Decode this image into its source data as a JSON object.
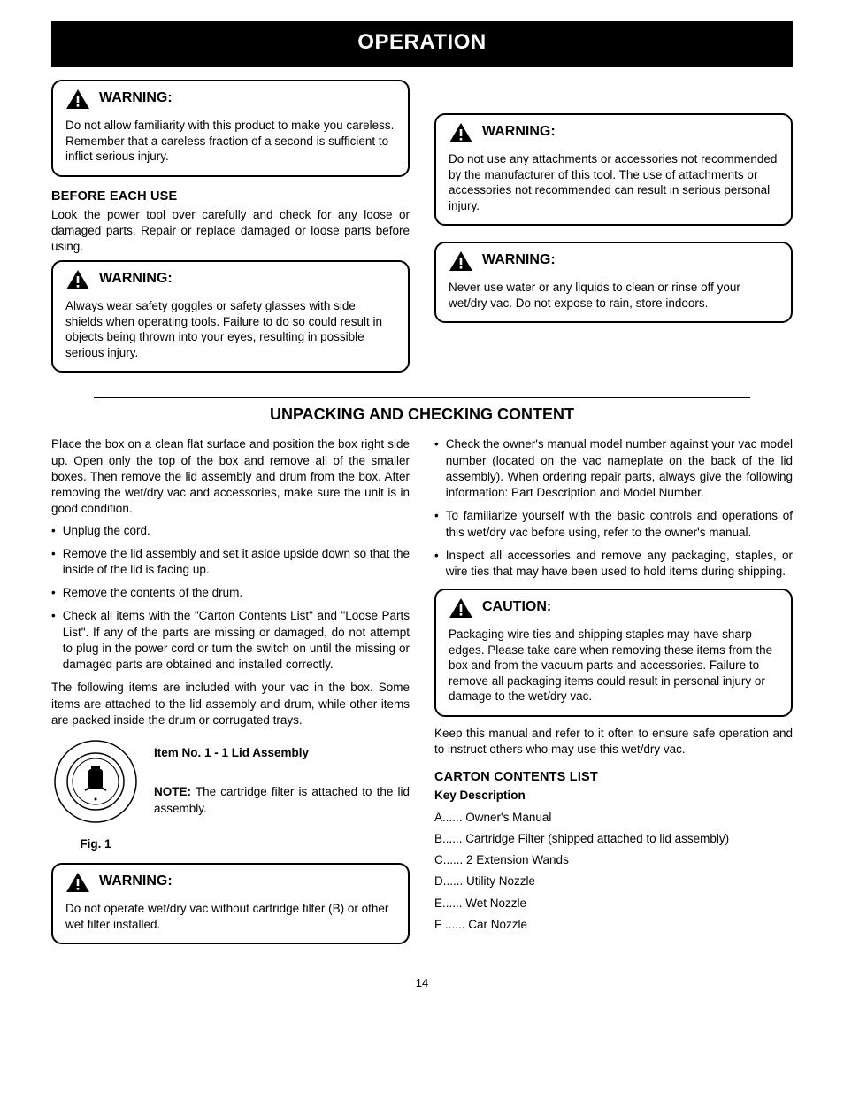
{
  "title": "OPERATION",
  "page_number": "14",
  "left": {
    "box1": {
      "label": "WARNING:",
      "text": "Do not allow familiarity with this product to make you careless. Remember that a careless fraction of a second is sufficient to inflict serious injury."
    },
    "before_each_use": {
      "heading": "BEFORE EACH USE",
      "text": "Look the power tool over carefully and check for any loose or damaged parts. Repair or replace damaged or loose parts before using."
    },
    "box2": {
      "label": "WARNING:",
      "text": "Always wear safety goggles or safety glasses with side shields when operating tools. Failure to do so could result in objects being thrown into your eyes, resulting in possible serious injury."
    }
  },
  "right": {
    "box1": {
      "label": "WARNING:",
      "text": "Do not use any attachments or accessories not recommended by the manufacturer of this tool. The use of attachments or accessories not recommended can result in serious personal injury."
    },
    "box2": {
      "label": "WARNING:",
      "text": "Never use water or any liquids to clean or rinse off your wet/dry vac. Do not expose to rain, store indoors."
    }
  },
  "subtitle": "UNPACKING AND CHECKING CONTENT",
  "leftcol2": {
    "p1": "Place the box on a clean flat surface and position the box right side up. Open only the top of the box and remove all of the smaller boxes. Then remove the lid assembly and drum from the box. After removing the wet/dry vac and accessories, make sure the unit is in good condition.",
    "bul1": "Unplug the cord.",
    "bul2": "Remove the lid assembly and set it aside upside down so that the inside of the lid is facing up.",
    "bul3": "Remove the contents of the drum.",
    "bul4": "Check all items with the \"Carton Contents List\" and \"Loose Parts List\". If any of the parts are missing or damaged, do not attempt to plug in the power cord or turn the switch on until the missing or damaged parts are obtained and installed correctly.",
    "p2": "The following items are included with your vac in the box. Some items are attached to the lid assembly and drum, while other items are packed inside the drum or corrugated trays.",
    "fig_head": "Item No. 1  -  1 Lid Assembly",
    "fig_caption": "Fig. 1",
    "note_label": "NOTE:",
    "note_text": "The cartridge filter is attached to the lid assembly.",
    "warn_label": "WARNING:",
    "warn_text": "Do not operate wet/dry vac without cartridge filter (B) or other wet filter installed."
  },
  "rightcol2": {
    "bul1": "Check the owner's manual model number against your vac model number (located on the vac nameplate on the back of the lid assembly). When ordering repair parts, always give the following information: Part Description and Model Number.",
    "bul2": "To familiarize yourself with the basic controls and operations of this wet/dry vac before using, refer to the owner's manual.",
    "bul3": "Inspect all accessories and remove any packaging, staples, or wire ties that may have been used to hold items during shipping.",
    "caution_label": "CAUTION:",
    "caution_text": "Packaging wire ties and shipping staples may have sharp edges. Please take care when removing these items from the box and from the vacuum parts and accessories. Failure to remove all packaging items could result in personal injury or damage to the wet/dry vac.",
    "p1": "Keep this manual and refer to it often to ensure safe operation and to instruct others who may use this wet/dry vac.",
    "carton_heading": "CARTON CONTENTS LIST",
    "carton_intro": "Key  Description",
    "carton_a": "A...... Owner's Manual",
    "carton_b": "B...... Cartridge Filter (shipped attached to lid assembly)",
    "carton_c": "C...... 2 Extension Wands",
    "carton_d": "D...... Utility Nozzle",
    "carton_e": "E...... Wet Nozzle",
    "carton_f": "F ...... Car Nozzle"
  }
}
